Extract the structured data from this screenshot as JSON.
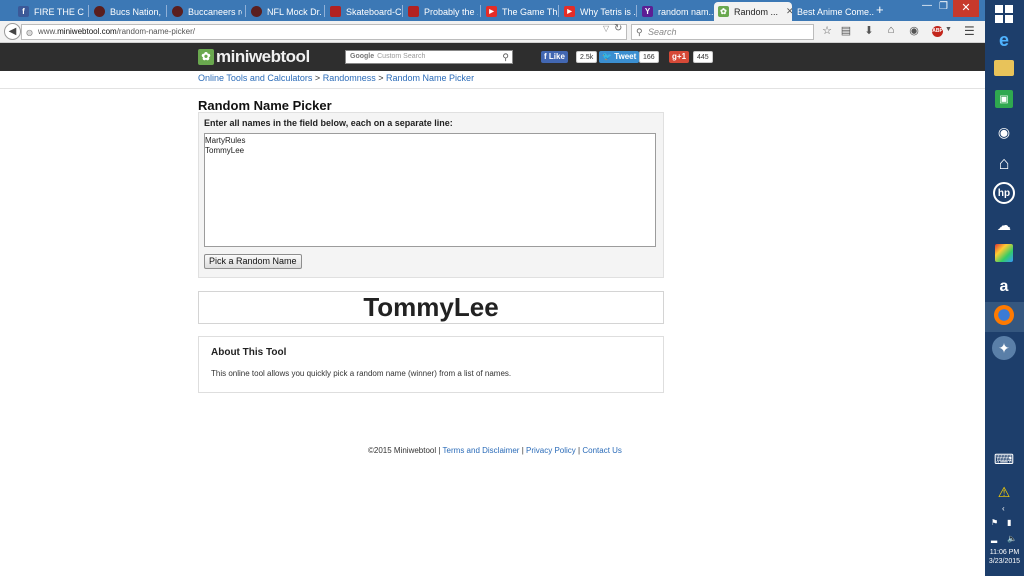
{
  "browser": {
    "tabs": [
      {
        "label": "FIRE THE CA...",
        "icon": "facebook-icon",
        "color": "#3b5998",
        "glyph": "f"
      },
      {
        "label": "Bucs Nation, ...",
        "icon": "sbnation-icon",
        "color": "#5a1e1e",
        "glyph": ""
      },
      {
        "label": "Buccaneers re...",
        "icon": "sbnation-icon",
        "color": "#5a1e1e",
        "glyph": ""
      },
      {
        "label": "NFL Mock Dr...",
        "icon": "sbnation-icon",
        "color": "#5a1e1e",
        "glyph": ""
      },
      {
        "label": "Skateboard-C...",
        "icon": "pickaxe-icon",
        "color": "#b22222",
        "glyph": ""
      },
      {
        "label": "Probably the ...",
        "icon": "pickaxe-icon",
        "color": "#b22222",
        "glyph": ""
      },
      {
        "label": "The Game Th...",
        "icon": "youtube-icon",
        "color": "#e52d27",
        "glyph": "▶"
      },
      {
        "label": "Why Tetris is ...",
        "icon": "youtube-icon",
        "color": "#e52d27",
        "glyph": "▶"
      },
      {
        "label": "random nam...",
        "icon": "yahoo-icon",
        "color": "#5c1f94",
        "glyph": "Y"
      },
      {
        "label": "Random ...",
        "icon": "miniwebtool-icon",
        "color": "#6aa84f",
        "glyph": "✿"
      },
      {
        "label": "Best Anime Come...",
        "icon": "",
        "color": "",
        "glyph": ""
      }
    ],
    "url_prefix": "www.",
    "url_domain": "miniwebtool.com",
    "url_path": "/random-name-picker/",
    "search_placeholder": "Search"
  },
  "site": {
    "logo_part1": "mini",
    "logo_part2": "webtool",
    "search_brand": "Google",
    "search_placeholder": "Custom Search",
    "fb_like": "Like",
    "fb_count": "2.5k",
    "tweet": "Tweet",
    "tweet_count": "166",
    "gplus": "+1",
    "gplus_count": "445"
  },
  "breadcrumb": {
    "items": [
      "Online Tools and Calculators",
      "Randomness",
      "Random Name Picker"
    ],
    "separator": ">"
  },
  "tool": {
    "title": "Random Name Picker",
    "instructions": "Enter all names in the field below, each on a separate line:",
    "names": "MartyRules\nTommyLee",
    "button_label": "Pick a Random Name",
    "result": "TommyLee"
  },
  "about": {
    "title": "About This Tool",
    "text": "This online tool allows you quickly pick a random name (winner) from a list of names."
  },
  "footer": {
    "copyright": "©2015 Miniwebtool",
    "sep": "|",
    "links": [
      "Terms and Disclaimer",
      "Privacy Policy",
      "Contact Us"
    ]
  },
  "taskbar": {
    "time": "11:06 PM",
    "date": "3/23/2015"
  }
}
